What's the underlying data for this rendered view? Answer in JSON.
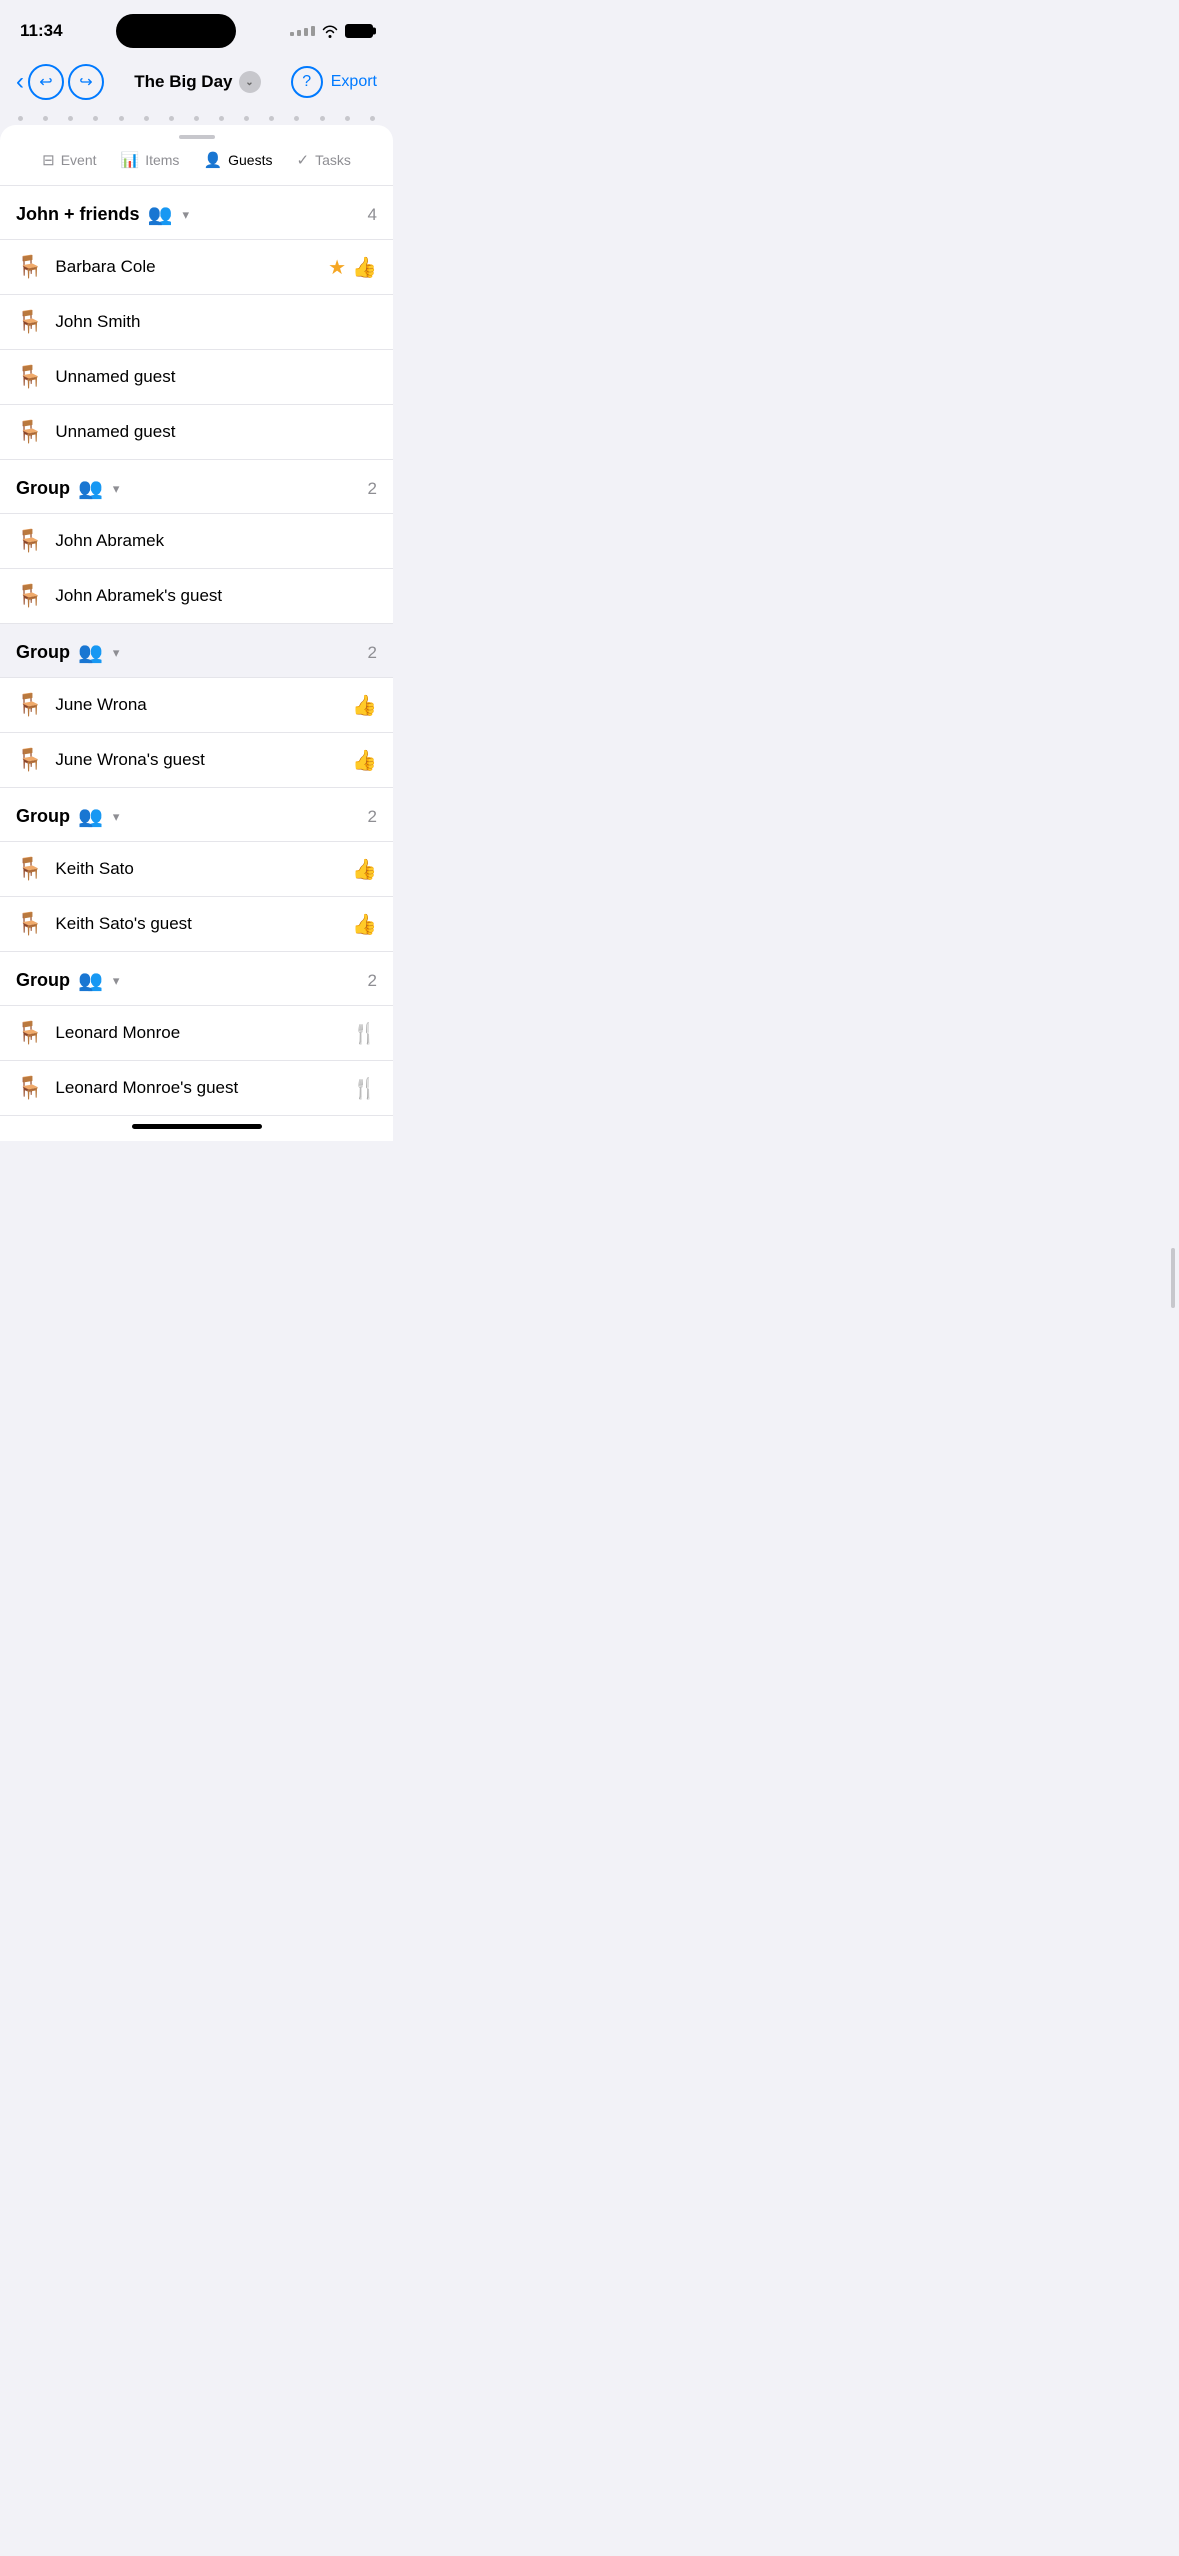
{
  "statusBar": {
    "time": "11:34",
    "icons": {
      "signal": "signal",
      "wifi": "wifi",
      "battery": "battery"
    }
  },
  "navBar": {
    "backLabel": "‹",
    "undoIcon": "↩",
    "redoIcon": "↪",
    "title": "The Big Day",
    "dropdownIcon": "⌄",
    "helpIcon": "?",
    "exportLabel": "Export"
  },
  "tabs": [
    {
      "id": "event",
      "label": "Event",
      "icon": "☰",
      "active": false
    },
    {
      "id": "items",
      "label": "Items",
      "icon": "📊",
      "active": false
    },
    {
      "id": "guests",
      "label": "Guests",
      "icon": "👤",
      "active": true
    },
    {
      "id": "tasks",
      "label": "Tasks",
      "icon": "✓",
      "active": false
    }
  ],
  "groups": [
    {
      "id": "john-friends",
      "title": "John + friends",
      "iconColor": "pink",
      "count": 4,
      "guests": [
        {
          "name": "Barbara Cole",
          "chairColor": "tan",
          "badges": [
            "star",
            "thumbup"
          ]
        },
        {
          "name": "John Smith",
          "chairColor": "tan",
          "badges": []
        },
        {
          "name": "Unnamed guest",
          "chairColor": "tan",
          "badges": []
        },
        {
          "name": "Unnamed guest",
          "chairColor": "tan",
          "badges": []
        }
      ]
    },
    {
      "id": "group-1",
      "title": "Group",
      "iconColor": "blue",
      "count": 2,
      "guests": [
        {
          "name": "John Abramek",
          "chairColor": "gray",
          "badges": []
        },
        {
          "name": "John Abramek's guest",
          "chairColor": "gray",
          "badges": []
        }
      ]
    },
    {
      "id": "group-2",
      "title": "Group",
      "iconColor": "blue",
      "count": 2,
      "highlighted": true,
      "guests": [
        {
          "name": "June Wrona",
          "chairColor": "tan",
          "badges": [
            "thumbup"
          ]
        },
        {
          "name": "June Wrona's guest",
          "chairColor": "tan",
          "badges": [
            "thumbup"
          ]
        }
      ]
    },
    {
      "id": "group-3",
      "title": "Group",
      "iconColor": "green",
      "count": 2,
      "guests": [
        {
          "name": "Keith Sato",
          "chairColor": "gray",
          "badges": [
            "thumbup"
          ]
        },
        {
          "name": "Keith Sato's guest",
          "chairColor": "gray",
          "badges": [
            "thumbup"
          ]
        }
      ]
    },
    {
      "id": "group-4",
      "title": "Group",
      "iconColor": "orange",
      "count": 2,
      "guests": [
        {
          "name": "Leonard Monroe",
          "chairColor": "gray",
          "badges": [
            "fork"
          ]
        },
        {
          "name": "Leonard Monroe's guest",
          "chairColor": "gray",
          "badges": [
            "fork"
          ]
        }
      ]
    }
  ]
}
